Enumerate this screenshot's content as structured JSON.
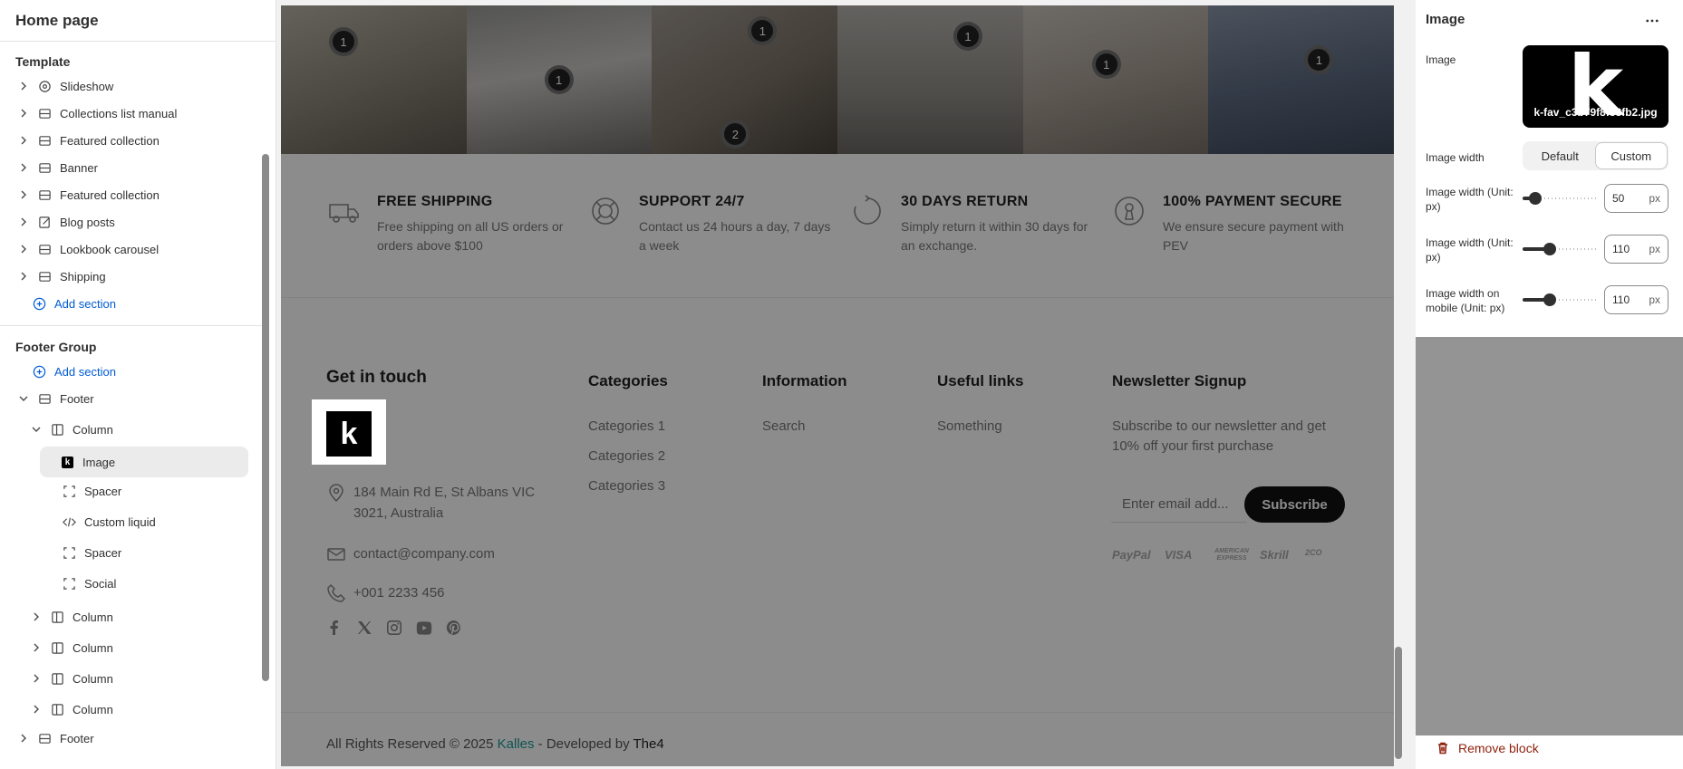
{
  "sidebar": {
    "title": "Home page",
    "template_label": "Template",
    "template_items": [
      {
        "label": "Slideshow",
        "icon": "slideshow-icon"
      },
      {
        "label": "Collections list manual",
        "icon": "section-icon"
      },
      {
        "label": "Featured collection",
        "icon": "section-icon"
      },
      {
        "label": "Banner",
        "icon": "section-icon"
      },
      {
        "label": "Featured collection",
        "icon": "section-icon"
      },
      {
        "label": "Blog posts",
        "icon": "blog-icon"
      },
      {
        "label": "Lookbook carousel",
        "icon": "section-icon"
      },
      {
        "label": "Shipping",
        "icon": "section-icon"
      }
    ],
    "add_section": "Add section",
    "footer_group_label": "Footer Group",
    "footer_add_section": "Add section",
    "footer_label": "Footer",
    "column_label": "Column",
    "blocks": [
      "Image",
      "Spacer",
      "Custom liquid",
      "Spacer",
      "Social"
    ],
    "collapsed_columns": [
      "Column",
      "Column",
      "Column",
      "Column"
    ],
    "bottom_footer": "Footer"
  },
  "preview": {
    "lookbook_hotspots": [
      "1",
      "1",
      "1",
      "2",
      "1",
      "1",
      "1"
    ],
    "features": [
      {
        "title": "FREE SHIPPING",
        "text": "Free shipping on all US orders or orders above $100",
        "icon": "truck-icon"
      },
      {
        "title": "SUPPORT 24/7",
        "text": "Contact us 24 hours a day, 7 days a week",
        "icon": "lifebuoy-icon"
      },
      {
        "title": "30 DAYS RETURN",
        "text": "Simply return it within 30 days for an exchange.",
        "icon": "return-icon"
      },
      {
        "title": "100% PAYMENT SECURE",
        "text": "We ensure secure payment with PEV",
        "icon": "keyhole-icon"
      }
    ],
    "footer": {
      "get_in_touch": "Get in touch",
      "logo_letter": "k",
      "address": "184 Main Rd E, St Albans VIC 3021, Australia",
      "email": "contact@company.com",
      "phone": "+001 2233 456",
      "categories_title": "Categories",
      "categories": [
        "Categories 1",
        "Categories 2",
        "Categories 3"
      ],
      "information_title": "Information",
      "information": [
        "Search"
      ],
      "useful_title": "Useful links",
      "useful": [
        "Something"
      ],
      "newsletter_title": "Newsletter Signup",
      "newsletter_text": "Subscribe to our newsletter and get 10% off your first purchase",
      "email_placeholder": "Enter email add...",
      "subscribe": "Subscribe",
      "payments": [
        "PayPal",
        "VISA",
        "AMERICAN EXPRESS",
        "Skrill",
        "2CO"
      ]
    },
    "copyright": {
      "prefix": "All Rights Reserved © 2025 ",
      "brand": "Kalles",
      "middle": " - Developed by ",
      "developer": "The4"
    }
  },
  "panel": {
    "title": "Image",
    "image_label": "Image",
    "image_letter": "k",
    "image_filename": "k-fav_c3b79f8f58fb2.jpg",
    "image_width_label": "Image width",
    "seg_default": "Default",
    "seg_custom": "Custom",
    "sliders": [
      {
        "label": "Image width (Unit: px)",
        "value": "50",
        "unit": "px",
        "fraction": 0.1
      },
      {
        "label": "Image width (Unit: px)",
        "value": "110",
        "unit": "px",
        "fraction": 0.33
      },
      {
        "label": "Image width on mobile (Unit: px)",
        "value": "110",
        "unit": "px",
        "fraction": 0.33
      }
    ],
    "remove_block": "Remove block"
  }
}
